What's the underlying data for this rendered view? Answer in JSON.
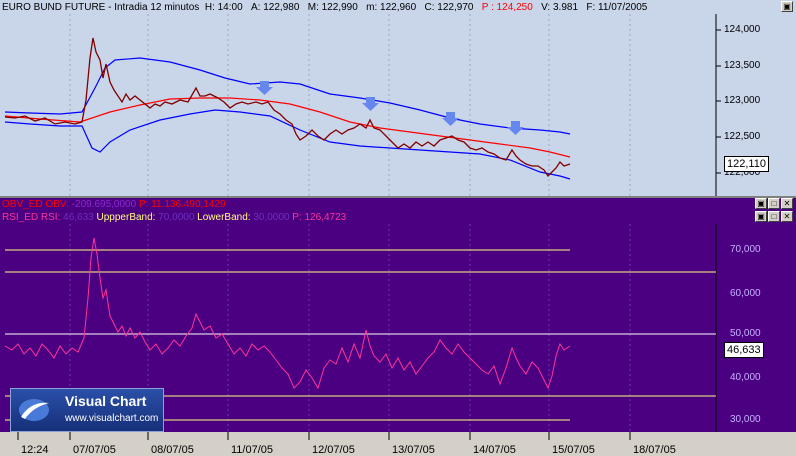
{
  "price_pane": {
    "header": "EURO BUND FUTURE - Intradia 12 minutos",
    "stats": [
      {
        "label": "H:",
        "value": "14:00"
      },
      {
        "label": "A:",
        "value": "122,980"
      },
      {
        "label": "M:",
        "value": "122,990"
      },
      {
        "label": "m:",
        "value": "122,960"
      },
      {
        "label": "C:",
        "value": "122,970"
      },
      {
        "label": "P :",
        "value": "124,250",
        "color": "#ff0000"
      },
      {
        "label": "V:",
        "value": "3.981"
      },
      {
        "label": "F:",
        "value": "11/07/2005"
      }
    ],
    "y_ticks": [
      "124,000",
      "123,500",
      "123,000",
      "122,500",
      "122,000"
    ],
    "last_price": "122,110",
    "colors": {
      "background": "#c9d5e9",
      "bands": "#0000ff",
      "ma": "#ff0000",
      "price": "#800000",
      "arrows": "#6688ee"
    }
  },
  "obv_pane": {
    "label": "OBV_ED",
    "label2": "OBV:",
    "value": "-209.695,0000",
    "p_label": "P: 11.136.490,1429"
  },
  "rsi_pane": {
    "label": "RSI_ED",
    "rsi_label": "RSI:",
    "rsi_value": "46,633",
    "upper_label": "UppperBand:",
    "upper_value": "70,0000",
    "lower_label": "LowerBand:",
    "lower_value": "30,0000",
    "p_label": "P: 126,4723",
    "y_ticks": [
      "70,000",
      "60,000",
      "50,000",
      "40,000",
      "30,000"
    ],
    "last_value": "46,633",
    "colors": {
      "background": "#4b0082",
      "rsi": "#ff3399",
      "bands": "#ffff80",
      "midline": "#ffffff"
    }
  },
  "window_buttons": [
    "restore",
    "maximize",
    "close"
  ],
  "x_axis": [
    "12:24",
    "07/07/05",
    "08/07/05",
    "11/07/05",
    "12/07/05",
    "13/07/05",
    "14/07/05",
    "15/07/05",
    "18/07/05"
  ],
  "logo": {
    "title": "Visual Chart",
    "url": "www.visualchart.com"
  }
}
